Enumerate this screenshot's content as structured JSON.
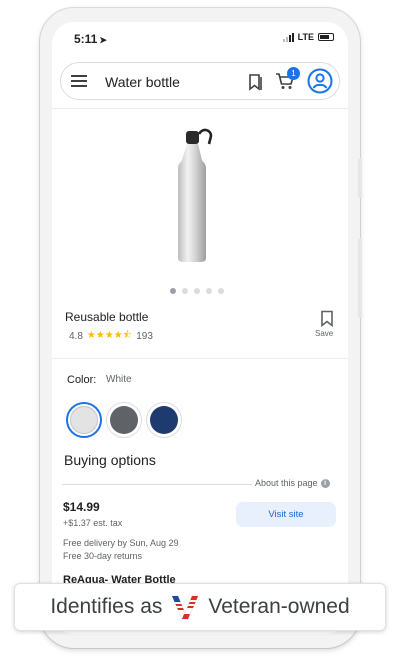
{
  "status_bar": {
    "time": "5:11",
    "network": "LTE"
  },
  "search": {
    "query": "Water bottle"
  },
  "cart": {
    "badge_count": "1"
  },
  "product": {
    "title": "Reusable bottle",
    "rating": "4.8",
    "rating_value": 4.8,
    "review_count": "193",
    "save_label": "Save",
    "carousel": {
      "total": 5,
      "active_index": 0
    }
  },
  "color": {
    "label": "Color:",
    "selected": "White",
    "swatches": [
      {
        "name": "White",
        "hex": "#e3e3e3",
        "selected": true
      },
      {
        "name": "Gray",
        "hex": "#5f6368",
        "selected": false
      },
      {
        "name": "Navy",
        "hex": "#1f3a6e",
        "selected": false
      }
    ]
  },
  "buying": {
    "heading": "Buying options",
    "about_label": "About this page",
    "price": "$14.99",
    "tax": "+$1.37 est. tax",
    "visit_label": "Visit site",
    "delivery": "Free delivery by Sun, Aug 29",
    "returns": "Free 30-day returns",
    "seller": "ReAqua- Water Bottle"
  },
  "banner": {
    "prefix": "Identifies as",
    "suffix": "Veteran-owned"
  },
  "colors": {
    "accent": "#1a73e8",
    "star": "#fbbc04",
    "visit_bg": "#e8f0fe"
  }
}
